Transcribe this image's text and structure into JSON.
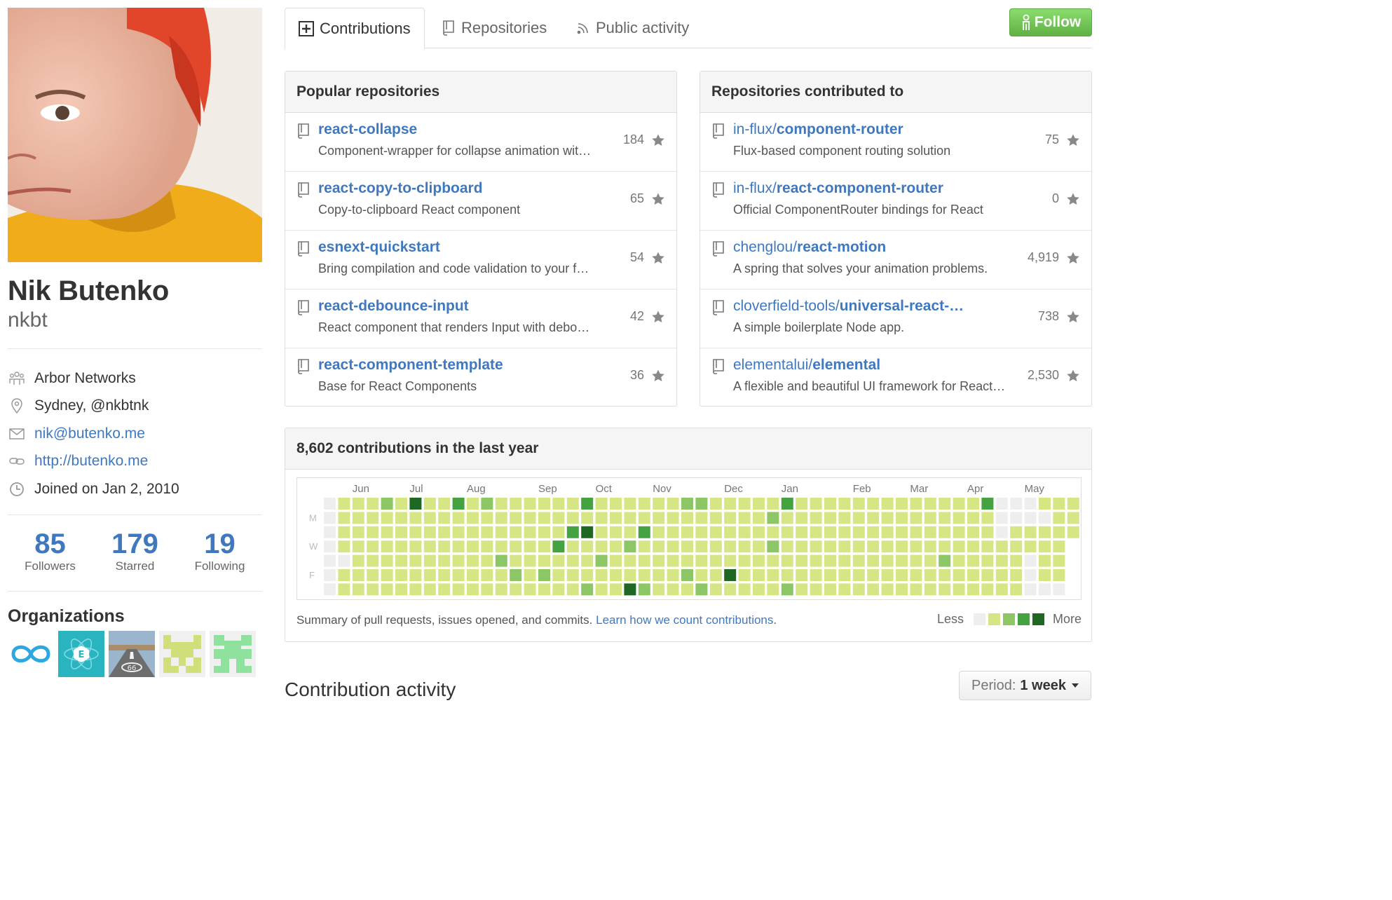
{
  "profile": {
    "fullname": "Nik Butenko",
    "username": "nkbt",
    "company": "Arbor Networks",
    "location": "Sydney, @nkbtnk",
    "email": "nik@butenko.me",
    "website": "http://butenko.me",
    "joined": "Joined on Jan 2, 2010"
  },
  "stats": [
    {
      "num": "85",
      "label": "Followers"
    },
    {
      "num": "179",
      "label": "Starred"
    },
    {
      "num": "19",
      "label": "Following"
    }
  ],
  "organizations": {
    "title": "Organizations",
    "items": [
      "infinity-org",
      "electron-org",
      "route66-org",
      "identicon-yellow-org",
      "identicon-green-org"
    ]
  },
  "tabs": {
    "contributions": "Contributions",
    "repositories": "Repositories",
    "public_activity": "Public activity"
  },
  "follow_label": "Follow",
  "popular": {
    "title": "Popular repositories",
    "items": [
      {
        "name": "react-collapse",
        "desc": "Component-wrapper for collapse animation wit…",
        "stars": "184"
      },
      {
        "name": "react-copy-to-clipboard",
        "desc": "Copy-to-clipboard React component",
        "stars": "65"
      },
      {
        "name": "esnext-quickstart",
        "desc": "Bring compilation and code validation to your f…",
        "stars": "54"
      },
      {
        "name": "react-debounce-input",
        "desc": "React component that renders Input with debo…",
        "stars": "42"
      },
      {
        "name": "react-component-template",
        "desc": "Base for React Components",
        "stars": "36"
      }
    ]
  },
  "contributed": {
    "title": "Repositories contributed to",
    "items": [
      {
        "owner": "in-flux/",
        "name": "component-router",
        "desc": "Flux-based component routing solution",
        "stars": "75"
      },
      {
        "owner": "in-flux/",
        "name": "react-component-router",
        "desc": "Official ComponentRouter bindings for React",
        "stars": "0"
      },
      {
        "owner": "chenglou/",
        "name": "react-motion",
        "desc": "A spring that solves your animation problems.",
        "stars": "4,919"
      },
      {
        "owner": "cloverfield-tools/",
        "name": "universal-react-…",
        "desc": "A simple boilerplate Node app.",
        "stars": "738"
      },
      {
        "owner": "elementalui/",
        "name": "elemental",
        "desc": "A flexible and beautiful UI framework for React…",
        "stars": "2,530"
      }
    ]
  },
  "contributions": {
    "title": "8,602 contributions in the last year",
    "months": [
      "Jun",
      "Jul",
      "Aug",
      "Sep",
      "Oct",
      "Nov",
      "Dec",
      "Jan",
      "Feb",
      "Mar",
      "Apr",
      "May"
    ],
    "days": [
      "M",
      "W",
      "F"
    ],
    "summary": "Summary of pull requests, issues opened, and commits.",
    "learn_link": "Learn how we count contributions",
    "period": ".",
    "less": "Less",
    "more": "More",
    "colors": [
      "#eeeeee",
      "#d6e685",
      "#8cc665",
      "#44a340",
      "#1e6823"
    ]
  },
  "activity": {
    "title": "Contribution activity",
    "period_label": "Period:",
    "period_value": "1 week"
  }
}
